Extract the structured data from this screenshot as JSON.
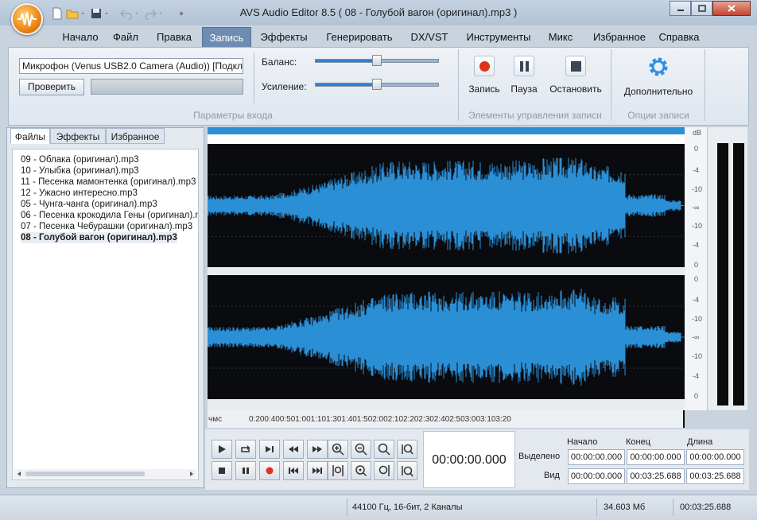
{
  "window": {
    "title": "AVS Audio Editor 8.5  ( 08 - Голубой вагон (оригинал).mp3 )"
  },
  "menu_tabs": [
    {
      "label": "Начало"
    },
    {
      "label": "Файл"
    },
    {
      "label": "Правка"
    },
    {
      "label": "Запись",
      "active": true
    },
    {
      "label": "Эффекты"
    },
    {
      "label": "Генерировать"
    },
    {
      "label": "DX/VST"
    },
    {
      "label": "Инструменты"
    },
    {
      "label": "Микс"
    },
    {
      "label": "Избранное"
    },
    {
      "label": "Справка"
    }
  ],
  "ribbon": {
    "input_device": "Микрофон (Venus USB2.0 Camera (Audio)) [Подключ",
    "check_button": "Проверить",
    "balance_label": "Баланс:",
    "gain_label": "Усиление:",
    "balance_value": 0.5,
    "gain_value": 0.5,
    "group_input": "Параметры входа",
    "record": "Запись",
    "pause": "Пауза",
    "stop": "Остановить",
    "group_controls": "Элементы управления записи",
    "more": "Дополнительно",
    "group_options": "Опции записи"
  },
  "left_panel": {
    "tabs": [
      "Файлы",
      "Эффекты",
      "Избранное"
    ],
    "files": [
      "09 - Облака (оригинал).mp3",
      "10 - Улыбка (оригинал).mp3",
      "11 - Песенка мамонтенка (оригинал).mp3",
      "12 - Ужасно интересно.mp3",
      "05 - Чунга-чанга (оригинал).mp3",
      "06 - Песенка крокодила Гены (оригинал).m",
      "07 - Песенка Чебурашки (оригинал).mp3",
      "08 - Голубой вагон (оригинал).mp3"
    ],
    "selected_file": "08 - Голубой вагон (оригинал).mp3"
  },
  "db_scale": [
    "dB",
    "0",
    "-4",
    "-10",
    "-∞",
    "-10",
    "-4",
    "0"
  ],
  "timeline": [
    "чмс",
    "0:20",
    "0:40",
    "0:50",
    "1:00",
    "1:10",
    "1:30",
    "1:40",
    "1:50",
    "2:00",
    "2:10",
    "2:20",
    "2:30",
    "2:40",
    "2:50",
    "3:00",
    "3:10",
    "3:20"
  ],
  "clock": "00:00:00.000",
  "selection_table": {
    "headers": [
      "Начало",
      "Конец",
      "Длина"
    ],
    "rows": [
      {
        "label": "Выделено",
        "values": [
          "00:00:00.000",
          "00:00:00.000",
          "00:00:00.000"
        ]
      },
      {
        "label": "Вид",
        "values": [
          "00:00:00.000",
          "00:03:25.688",
          "00:03:25.688"
        ]
      }
    ]
  },
  "status": {
    "format": "44100 Гц, 16-бит, 2 Каналы",
    "size": "34.603 Мб",
    "duration": "00:03:25.688"
  },
  "colors": {
    "wave": "#2b8fd6",
    "wave_bg": "#0a0b0f",
    "accent": "#6e8bb1",
    "record_red": "#e0321c"
  }
}
